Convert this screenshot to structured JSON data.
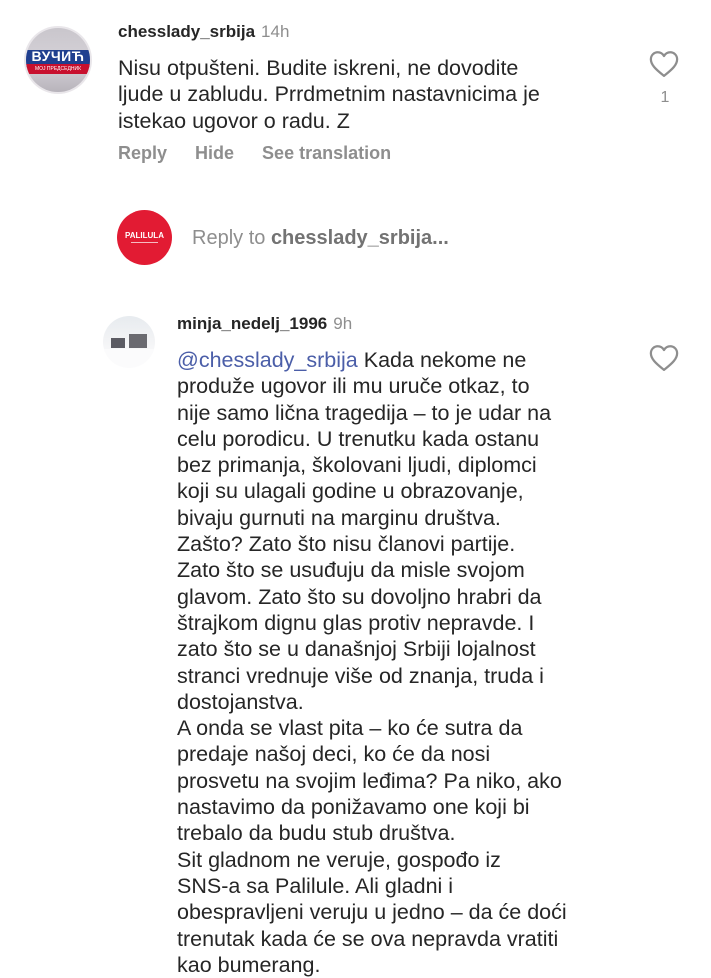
{
  "comments": [
    {
      "username": "chesslady_srbija",
      "time": "14h",
      "text": "Nisu otpušteni. Budite iskreni, ne dovodite\nljude u zabludu. Prrdmetnim nastavnicima je\nistekao ugovor o radu. Z",
      "likes": "1",
      "avatar_text": "ВУЧИЋ",
      "avatar_subtext": "МОЈ ПРЕДСЕДНИК",
      "actions": {
        "reply": "Reply",
        "hide": "Hide",
        "translate": "See translation"
      }
    },
    {
      "username": "minja_nedelj_1996",
      "time": "9h",
      "mention": "@chesslady_srbija",
      "text_first": " Kada nekome ne",
      "text_rest": "produže ugovor ili mu uruče otkaz, to\nnije samo lična tragedija – to je udar na\ncelu porodicu. U trenutku kada ostanu\nbez primanja, školovani ljudi, diplomci\nkoji su ulagali godine u obrazovanje,\nbivaju gurnuti na marginu društva.\nZašto? Zato što nisu članovi partije.\nZato što se usuđuju da misle svojom\nglavom. Zato što su dovoljno hrabri da\nštrajkom dignu glas protiv nepravde. I\nzato što se u današnjoj Srbiji lojalnost\nstranci vrednuje više od znanja, truda i\ndostojanstva.\nA onda se vlast pita – ko će sutra da\npredaje našoj deci, ko će da nosi\nprosvetu na svojim leđima? Pa niko, ako\nnastavimo da ponižavamo one koji bi\ntrebalo da budu stub društva.\nSit gladnom ne veruje, gospođo iz\nSNS-a sa Palilule. Ali gladni i\nobespravljeni veruju u jedno – da će doći\ntrenutak kada će se ova nepravda vratiti\nkao bumerang."
    }
  ],
  "reply_box": {
    "prefix": "Reply to ",
    "target": "chesslady_srbija...",
    "avatar_text": "PALILULA"
  },
  "colors": {
    "accent_red": "#d7263d",
    "muted": "#8e8e8e",
    "mention": "#4b5ea8"
  }
}
